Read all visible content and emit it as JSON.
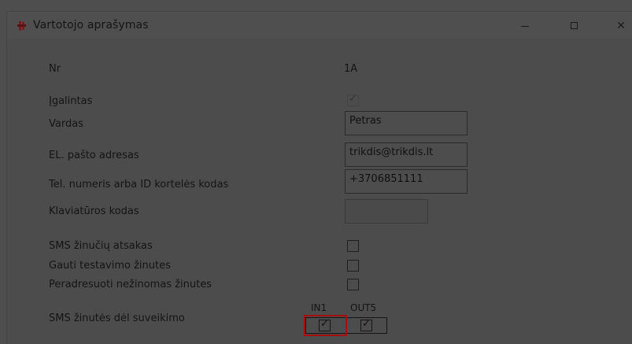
{
  "window": {
    "title": "Vartotojo aprašymas",
    "controls": {
      "minimize": "—",
      "maximize": "☐",
      "close": "✕"
    }
  },
  "form": {
    "nr_label": "Nr",
    "nr_value": "1A",
    "enabled_label": "Įgalintas",
    "enabled_checked": true,
    "name_label": "Vardas",
    "name_value": "Petras",
    "email_label": "EL. pašto adresas",
    "email_value": "trikdis@trikdis.lt",
    "phone_label": "Tel. numeris arba ID kortelės kodas",
    "phone_value": "+3706851111",
    "keypad_label": "Klaviatūros kodas",
    "keypad_value": "",
    "sms_reply_label": "SMS žinučių atsakas",
    "sms_reply_checked": false,
    "test_msgs_label": "Gauti testavimo žinutes",
    "test_msgs_checked": false,
    "forward_label": "Peradresuoti nežinomas žinutes",
    "forward_checked": false,
    "trigger_label": "SMS žinutės dėl suveikimo",
    "in1_label": "IN1",
    "in1_checked": true,
    "out5_label": "OUT5",
    "out5_checked": true
  },
  "colors": {
    "highlight": "#a01010"
  },
  "icons": {
    "app": "app-icon",
    "check": "check-icon"
  }
}
